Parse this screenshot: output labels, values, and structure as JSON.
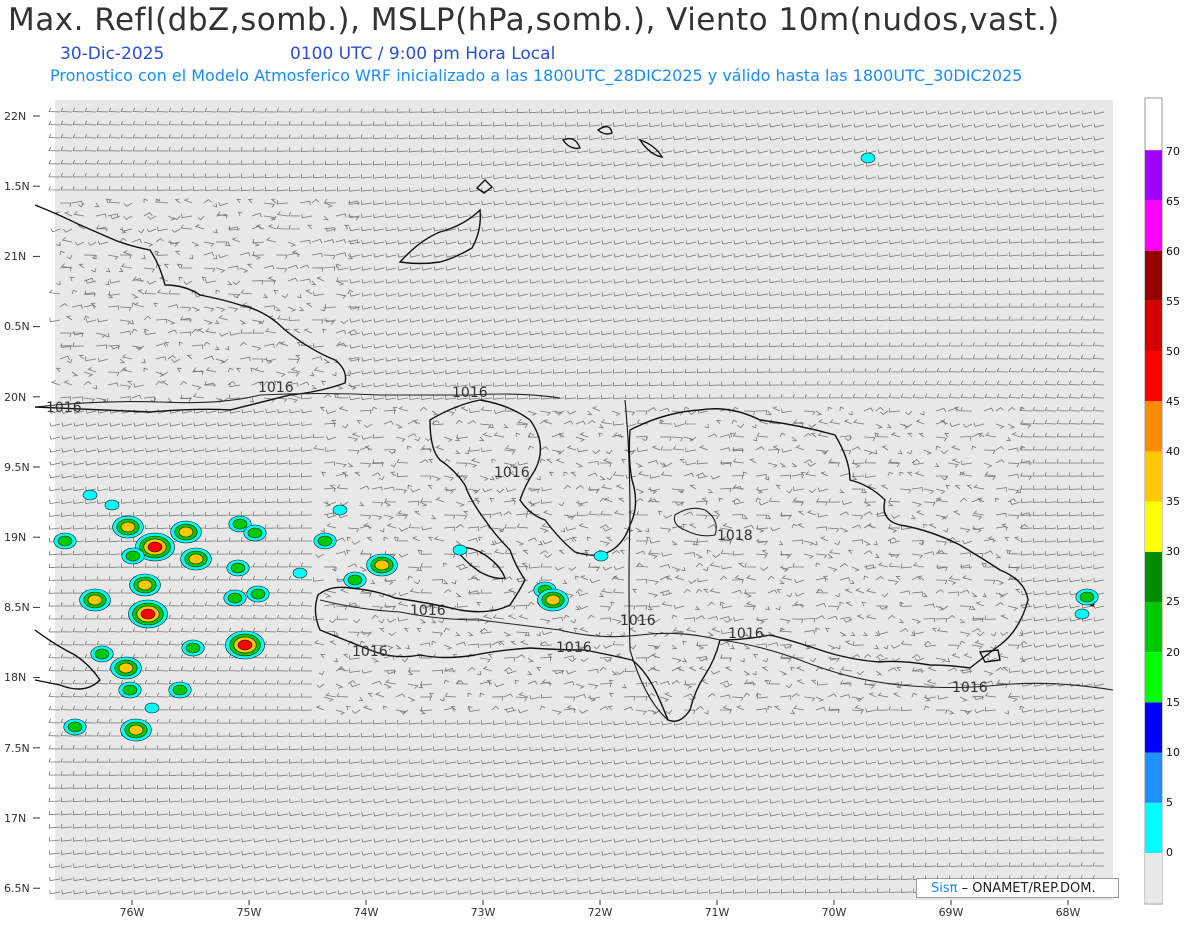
{
  "header": {
    "title": "Max. Refl(dbZ,somb.), MSLP(hPa,somb.), Viento 10m(nudos,vast.)",
    "date": "30-Dic-2025",
    "time": "0100 UTC / 9:00 pm Hora Local",
    "description": "Pronostico con el Modelo Atmosferico WRF inicializado a las 1800UTC_28DIC2025 y válido hasta las  1800UTC_30DIC2025"
  },
  "axes": {
    "lat_labels": [
      "22N",
      "1.5N",
      "21N",
      "0.5N",
      "20N",
      "9.5N",
      "19N",
      "8.5N",
      "18N",
      "7.5N",
      "17N",
      "6.5N"
    ],
    "lon_labels": [
      "76W",
      "75W",
      "74W",
      "73W",
      "72W",
      "71W",
      "70W",
      "69W",
      "68W"
    ]
  },
  "isobars": [
    "1016",
    "1016",
    "1016",
    "1016",
    "1016",
    "1016",
    "1016",
    "1016",
    "1016",
    "1016",
    "1018"
  ],
  "colorbar": {
    "labels": [
      "0",
      "5",
      "10",
      "15",
      "20",
      "25",
      "30",
      "35",
      "40",
      "45",
      "50",
      "55",
      "60",
      "65",
      "70"
    ],
    "colors": [
      "#00ffff",
      "#1e90ff",
      "#0000ff",
      "#00ff00",
      "#00c800",
      "#008c00",
      "#ffff00",
      "#ffc800",
      "#ff8c00",
      "#ff0000",
      "#d20000",
      "#960000",
      "#ff00ff",
      "#a000ff"
    ]
  },
  "credit": {
    "sis": "Sisπ",
    "org": " – ONAMET/REP.DOM."
  }
}
